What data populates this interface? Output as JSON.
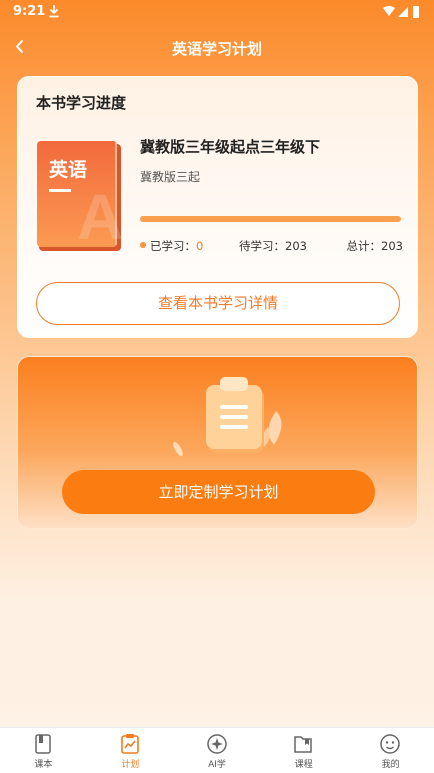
{
  "status_bar": {
    "time": "9:21"
  },
  "nav": {
    "title": "英语学习计划"
  },
  "progress_card": {
    "title": "本书学习进度",
    "cover": {
      "word": "英语",
      "letter": "A"
    },
    "book_name": "冀教版三年级起点三年级下",
    "edition": "冀教版三起",
    "progress_fraction": 1.0,
    "learned_label": "已学习：",
    "learned_value": "0",
    "pending_label": "待学习：",
    "pending_value": "203",
    "total_label": "总计：",
    "total_value": "203",
    "detail_button": "查看本书学习详情"
  },
  "plan_card": {
    "button": "立即定制学习计划"
  },
  "tabs": [
    {
      "label": "课本",
      "icon": "book-icon"
    },
    {
      "label": "计划",
      "icon": "plan-icon",
      "active": true
    },
    {
      "label": "AI学",
      "icon": "ai-icon"
    },
    {
      "label": "课程",
      "icon": "course-icon"
    },
    {
      "label": "我的",
      "icon": "profile-icon"
    }
  ],
  "colors": {
    "accent": "#f47c20",
    "header": "#fb8a2a"
  }
}
